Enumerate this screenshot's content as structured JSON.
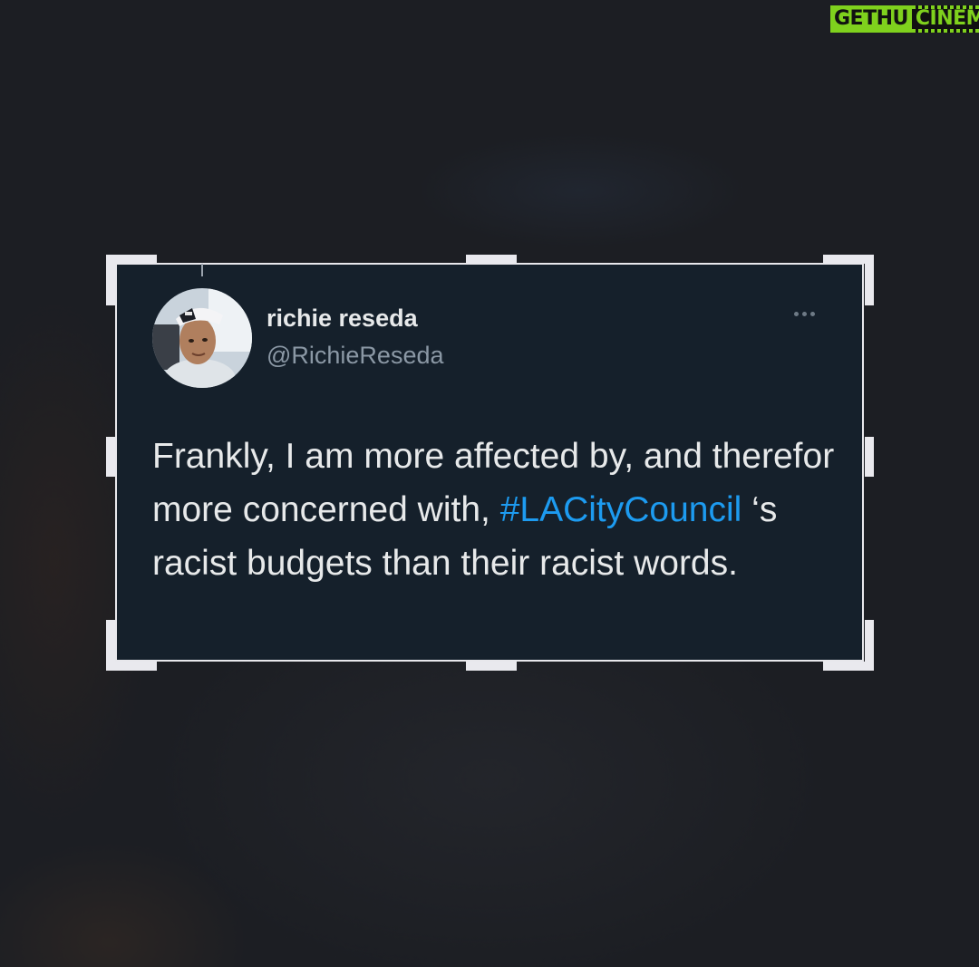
{
  "watermark": {
    "part1": "GETHU",
    "part2": "CINEMA"
  },
  "tweet": {
    "display_name": "richie reseda",
    "username": "@RichieReseda",
    "text_before": "Frankly, I am more affected by, and therefor more concerned with, ",
    "hashtag": "#LACityCouncil",
    "text_after": " ‘s racist budgets than their racist words.",
    "more_icon": "more-options-icon"
  },
  "colors": {
    "card_background": "#15202b",
    "hashtag": "#1d9bf0",
    "watermark_green": "#7fd11d"
  }
}
